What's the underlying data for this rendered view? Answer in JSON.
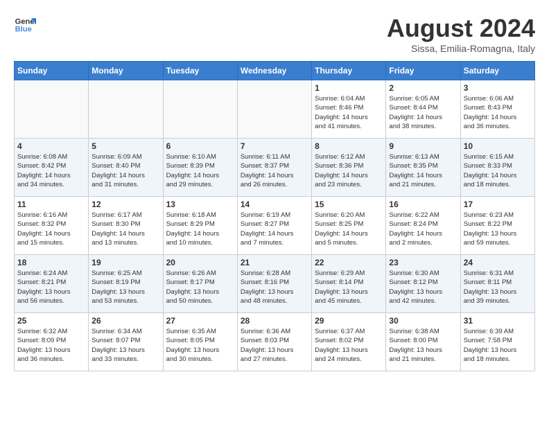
{
  "header": {
    "logo_general": "General",
    "logo_blue": "Blue",
    "month_year": "August 2024",
    "location": "Sissa, Emilia-Romagna, Italy"
  },
  "days_of_week": [
    "Sunday",
    "Monday",
    "Tuesday",
    "Wednesday",
    "Thursday",
    "Friday",
    "Saturday"
  ],
  "weeks": [
    [
      {
        "day": "",
        "info": ""
      },
      {
        "day": "",
        "info": ""
      },
      {
        "day": "",
        "info": ""
      },
      {
        "day": "",
        "info": ""
      },
      {
        "day": "1",
        "info": "Sunrise: 6:04 AM\nSunset: 8:46 PM\nDaylight: 14 hours\nand 41 minutes."
      },
      {
        "day": "2",
        "info": "Sunrise: 6:05 AM\nSunset: 8:44 PM\nDaylight: 14 hours\nand 38 minutes."
      },
      {
        "day": "3",
        "info": "Sunrise: 6:06 AM\nSunset: 8:43 PM\nDaylight: 14 hours\nand 36 minutes."
      }
    ],
    [
      {
        "day": "4",
        "info": "Sunrise: 6:08 AM\nSunset: 8:42 PM\nDaylight: 14 hours\nand 34 minutes."
      },
      {
        "day": "5",
        "info": "Sunrise: 6:09 AM\nSunset: 8:40 PM\nDaylight: 14 hours\nand 31 minutes."
      },
      {
        "day": "6",
        "info": "Sunrise: 6:10 AM\nSunset: 8:39 PM\nDaylight: 14 hours\nand 29 minutes."
      },
      {
        "day": "7",
        "info": "Sunrise: 6:11 AM\nSunset: 8:37 PM\nDaylight: 14 hours\nand 26 minutes."
      },
      {
        "day": "8",
        "info": "Sunrise: 6:12 AM\nSunset: 8:36 PM\nDaylight: 14 hours\nand 23 minutes."
      },
      {
        "day": "9",
        "info": "Sunrise: 6:13 AM\nSunset: 8:35 PM\nDaylight: 14 hours\nand 21 minutes."
      },
      {
        "day": "10",
        "info": "Sunrise: 6:15 AM\nSunset: 8:33 PM\nDaylight: 14 hours\nand 18 minutes."
      }
    ],
    [
      {
        "day": "11",
        "info": "Sunrise: 6:16 AM\nSunset: 8:32 PM\nDaylight: 14 hours\nand 15 minutes."
      },
      {
        "day": "12",
        "info": "Sunrise: 6:17 AM\nSunset: 8:30 PM\nDaylight: 14 hours\nand 13 minutes."
      },
      {
        "day": "13",
        "info": "Sunrise: 6:18 AM\nSunset: 8:29 PM\nDaylight: 14 hours\nand 10 minutes."
      },
      {
        "day": "14",
        "info": "Sunrise: 6:19 AM\nSunset: 8:27 PM\nDaylight: 14 hours\nand 7 minutes."
      },
      {
        "day": "15",
        "info": "Sunrise: 6:20 AM\nSunset: 8:25 PM\nDaylight: 14 hours\nand 5 minutes."
      },
      {
        "day": "16",
        "info": "Sunrise: 6:22 AM\nSunset: 8:24 PM\nDaylight: 14 hours\nand 2 minutes."
      },
      {
        "day": "17",
        "info": "Sunrise: 6:23 AM\nSunset: 8:22 PM\nDaylight: 13 hours\nand 59 minutes."
      }
    ],
    [
      {
        "day": "18",
        "info": "Sunrise: 6:24 AM\nSunset: 8:21 PM\nDaylight: 13 hours\nand 56 minutes."
      },
      {
        "day": "19",
        "info": "Sunrise: 6:25 AM\nSunset: 8:19 PM\nDaylight: 13 hours\nand 53 minutes."
      },
      {
        "day": "20",
        "info": "Sunrise: 6:26 AM\nSunset: 8:17 PM\nDaylight: 13 hours\nand 50 minutes."
      },
      {
        "day": "21",
        "info": "Sunrise: 6:28 AM\nSunset: 8:16 PM\nDaylight: 13 hours\nand 48 minutes."
      },
      {
        "day": "22",
        "info": "Sunrise: 6:29 AM\nSunset: 8:14 PM\nDaylight: 13 hours\nand 45 minutes."
      },
      {
        "day": "23",
        "info": "Sunrise: 6:30 AM\nSunset: 8:12 PM\nDaylight: 13 hours\nand 42 minutes."
      },
      {
        "day": "24",
        "info": "Sunrise: 6:31 AM\nSunset: 8:11 PM\nDaylight: 13 hours\nand 39 minutes."
      }
    ],
    [
      {
        "day": "25",
        "info": "Sunrise: 6:32 AM\nSunset: 8:09 PM\nDaylight: 13 hours\nand 36 minutes."
      },
      {
        "day": "26",
        "info": "Sunrise: 6:34 AM\nSunset: 8:07 PM\nDaylight: 13 hours\nand 33 minutes."
      },
      {
        "day": "27",
        "info": "Sunrise: 6:35 AM\nSunset: 8:05 PM\nDaylight: 13 hours\nand 30 minutes."
      },
      {
        "day": "28",
        "info": "Sunrise: 6:36 AM\nSunset: 8:03 PM\nDaylight: 13 hours\nand 27 minutes."
      },
      {
        "day": "29",
        "info": "Sunrise: 6:37 AM\nSunset: 8:02 PM\nDaylight: 13 hours\nand 24 minutes."
      },
      {
        "day": "30",
        "info": "Sunrise: 6:38 AM\nSunset: 8:00 PM\nDaylight: 13 hours\nand 21 minutes."
      },
      {
        "day": "31",
        "info": "Sunrise: 6:39 AM\nSunset: 7:58 PM\nDaylight: 13 hours\nand 18 minutes."
      }
    ]
  ]
}
